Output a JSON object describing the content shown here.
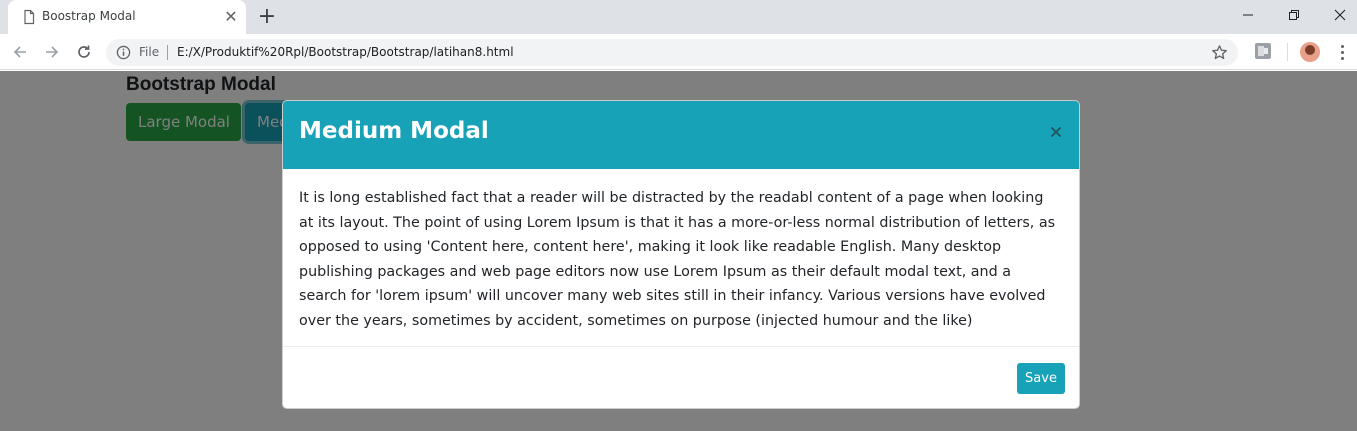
{
  "browser": {
    "tab_title": "Boostrap Modal",
    "new_tab_label": "+",
    "tab_close_label": "✕",
    "address": {
      "scheme_label": "File",
      "url": "E:/X/Produktif%20Rpl/Bootstrap/Bootstrap/latihan8.html"
    }
  },
  "page": {
    "heading": "Bootstrap Modal",
    "buttons": {
      "large_label": "Large Modal",
      "medium_label": "Medium Modal"
    }
  },
  "modal": {
    "title": "Medium Modal",
    "body": "It is long established fact that a reader will be distracted by the readabl content of a page when looking at its layout. The point of using Lorem Ipsum is that it has a more-or-less normal distribution of letters, as opposed to using 'Content here, content here', making it look like readable English. Many desktop publishing packages and web page editors now use Lorem Ipsum as their default modal text, and a search for 'lorem ipsum' will uncover many web sites still in their infancy. Various versions have evolved over the years, sometimes by accident, sometimes on purpose (injected humour and the like)",
    "save_label": "Save"
  },
  "colors": {
    "info": "#17a2b8",
    "success": "#28a745",
    "backdrop": "rgba(0,0,0,0.5)"
  },
  "icons": [
    "page-icon",
    "tab-close-icon",
    "new-tab-icon",
    "minimize-icon",
    "maximize-icon",
    "window-close-icon",
    "back-arrow-icon",
    "forward-arrow-icon",
    "reload-icon",
    "info-icon",
    "star-icon",
    "extension-icon",
    "avatar",
    "menu-icon",
    "modal-close-icon"
  ]
}
